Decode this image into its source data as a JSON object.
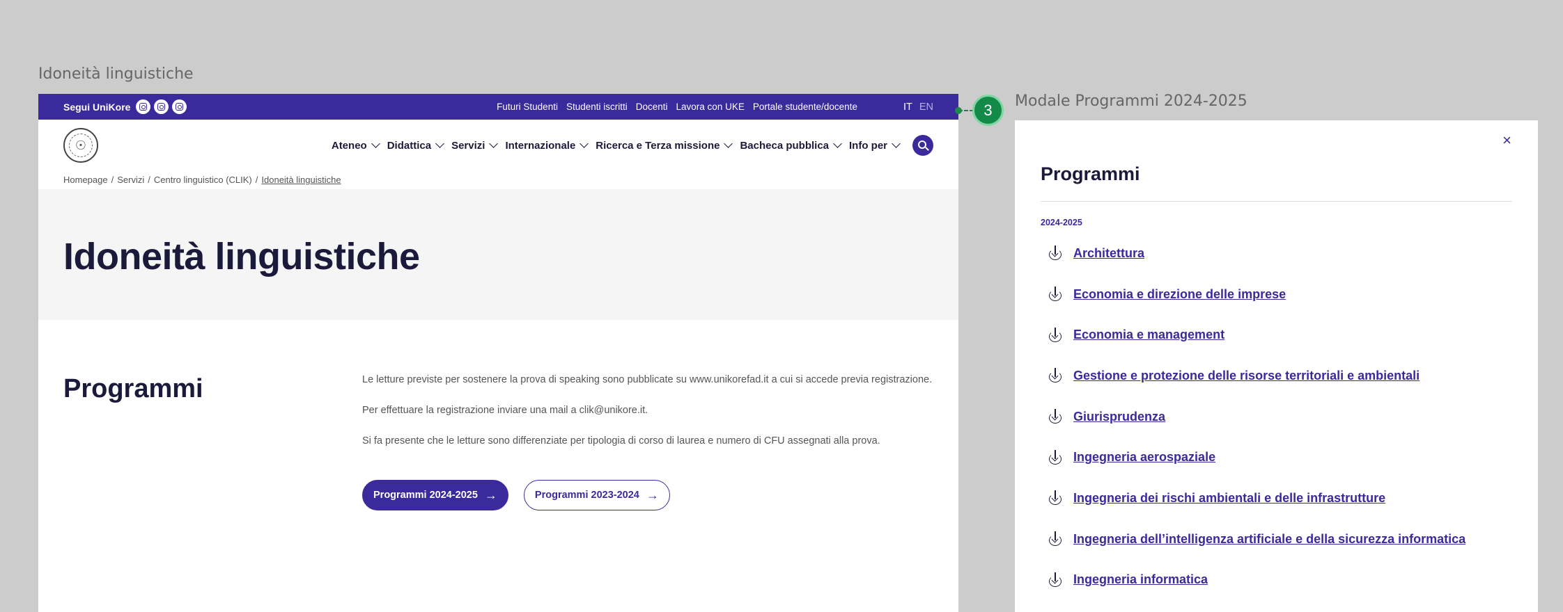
{
  "labels": {
    "main_frame": "Idoneità linguistiche",
    "modal_frame": "Modale Programmi 2024-2025",
    "step": "3"
  },
  "topbar": {
    "follow": "Segui UniKore",
    "social_icons": [
      "instagram-icon",
      "linkedin-icon",
      "facebook-icon"
    ],
    "links": [
      "Futuri Studenti",
      "Studenti iscritti",
      "Docenti",
      "Lavora con UKE",
      "Portale studente/docente"
    ],
    "lang_active": "IT",
    "lang_other": "EN"
  },
  "nav": {
    "items": [
      "Ateneo",
      "Didattica",
      "Servizi",
      "Internazionale",
      "Ricerca e Terza missione",
      "Bacheca pubblica",
      "Info per"
    ]
  },
  "breadcrumb": {
    "items": [
      "Homepage",
      "Servizi",
      "Centro linguistico (CLIK)"
    ],
    "current": "Idoneità linguistiche",
    "separator": "/"
  },
  "hero": {
    "title": "Idoneità linguistiche"
  },
  "section": {
    "title": "Programmi",
    "paragraphs": [
      "Le letture previste per sostenere la prova di speaking sono pubblicate su www.unikorefad.it a cui si accede  previa registrazione.",
      "Per effettuare la registrazione inviare una mail a clik@unikore.it.",
      "Si fa presente che le letture sono differenziate per tipologia di corso di laurea e numero di CFU assegnati alla prova."
    ],
    "btn_primary": "Programmi 2024-2025",
    "btn_secondary": "Programmi 2023-2024",
    "arrow": "→"
  },
  "modal": {
    "close": "×",
    "title": "Programmi",
    "year": "2024-2025",
    "items": [
      "Architettura",
      "Economia e direzione delle imprese",
      "Economia e management",
      "Gestione e protezione delle risorse territoriali e ambientali",
      "Giurisprudenza",
      "Ingegneria aerospaziale",
      "Ingegneria dei rischi ambientali e delle infrastrutture",
      "Ingegneria dell’intelligenza artificiale e della sicurezza informatica",
      "Ingegneria informatica"
    ]
  },
  "colors": {
    "brand": "#3a2a9c",
    "text": "#1c1a3a",
    "step_badge": "#138a48",
    "canvas": "#cccccc"
  }
}
